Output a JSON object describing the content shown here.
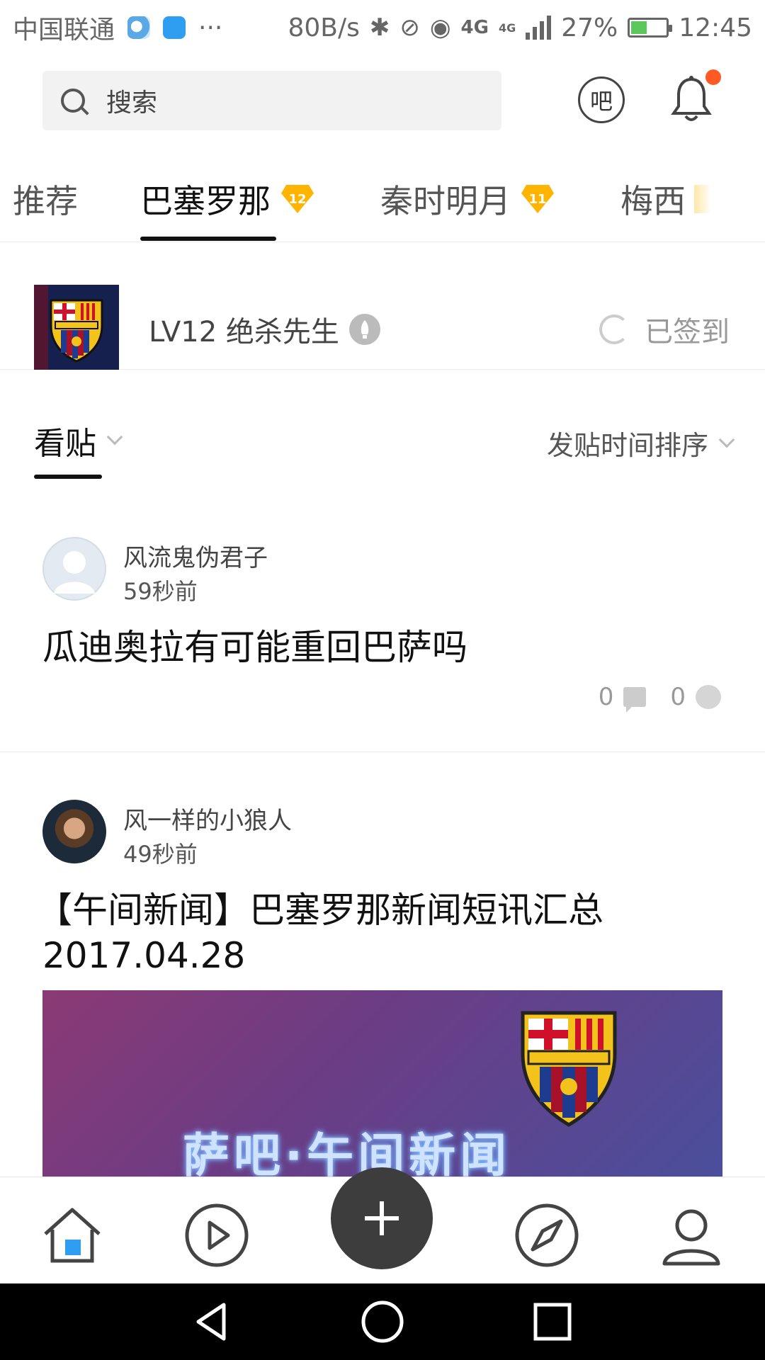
{
  "status_bar": {
    "carrier": "中国联通",
    "more": "···",
    "net_speed": "80B/s",
    "network": "4G",
    "network_small": "4G",
    "battery": "27%",
    "time": "12:45"
  },
  "header": {
    "search_placeholder": "搜索",
    "ba_button": "吧"
  },
  "tabs": [
    {
      "label": "推荐"
    },
    {
      "label": "巴塞罗那",
      "badge": "12"
    },
    {
      "label": "秦时明月",
      "badge": "11"
    },
    {
      "label": "梅西"
    }
  ],
  "forum": {
    "user_label": "LV12 绝杀先生",
    "signed_label": "已签到",
    "logo_text": "FC Barcelona"
  },
  "filter": {
    "view_label": "看贴",
    "sort_label": "发贴时间排序"
  },
  "posts": [
    {
      "author": "风流鬼伪君子",
      "time": "59秒前",
      "title": "瓜迪奥拉有可能重回巴萨吗",
      "comments": "0",
      "likes": "0"
    },
    {
      "author": "风一样的小狼人",
      "time": "49秒前",
      "title_line1": "【午间新闻】巴塞罗那新闻短讯汇总",
      "title_line2": "2017.04.28",
      "image_caption": "萨吧·午间新闻"
    }
  ],
  "colors": {
    "accent_badge": "#ffb400",
    "notification_dot": "#ff5a23",
    "home_active": "#2f9ef1",
    "fab": "#3d3d3d"
  }
}
